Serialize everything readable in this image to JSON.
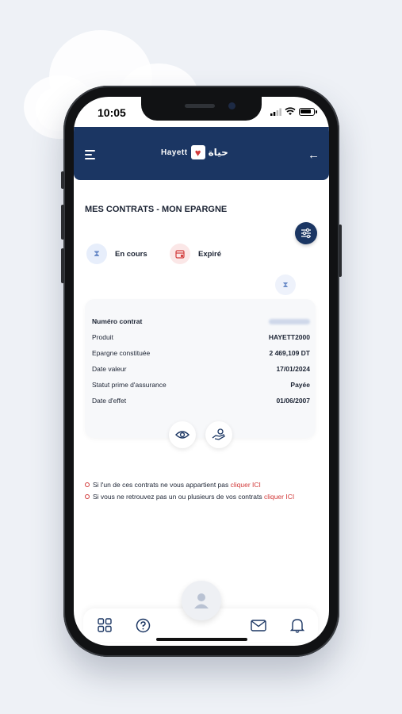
{
  "status_bar": {
    "time": "10:05",
    "battery_level": 0.85
  },
  "header": {
    "logo_latin": "Hayett",
    "logo_arabic": "حياة",
    "icons": {
      "menu": "hamburger-icon",
      "back": "arrow-left-icon"
    }
  },
  "page": {
    "title": "MES CONTRATS - MON EPARGNE"
  },
  "legend": [
    {
      "label": "En cours",
      "icon": "hourglass-icon",
      "color": "#6b8cc8",
      "bg": "#e7eefb"
    },
    {
      "label": "Expiré",
      "icon": "calendar-x-icon",
      "color": "#d23a3a",
      "bg": "#fbe7e7"
    }
  ],
  "contract": {
    "rows": [
      {
        "key": "Numéro contrat",
        "value": ""
      },
      {
        "key": "Produit",
        "value": "HAYETT2000"
      },
      {
        "key": "Epargne constituée",
        "value": "2 469,109 DT"
      },
      {
        "key": "Date valeur",
        "value": "17/01/2024"
      },
      {
        "key": "Statut prime d'assurance",
        "value": "Payée"
      },
      {
        "key": "Date d'effet",
        "value": "01/06/2007"
      }
    ],
    "actions": {
      "view": "eye-icon",
      "payment": "hand-coin-icon"
    }
  },
  "notes": [
    {
      "text": "Si l'un de ces contrats ne vous appartient pas ",
      "link": "cliquer ICI"
    },
    {
      "text": "Si vous ne retrouvez pas un ou plusieurs de vos contrats ",
      "link": "cliquer ICI"
    }
  ],
  "bottom_nav": {
    "icons": [
      "grid-icon",
      "help-icon",
      "user-avatar-icon",
      "mail-icon",
      "bell-icon"
    ]
  },
  "colors": {
    "primary": "#1b3663",
    "accent_red": "#d23a3a",
    "accent_blue": "#6b8cc8"
  }
}
